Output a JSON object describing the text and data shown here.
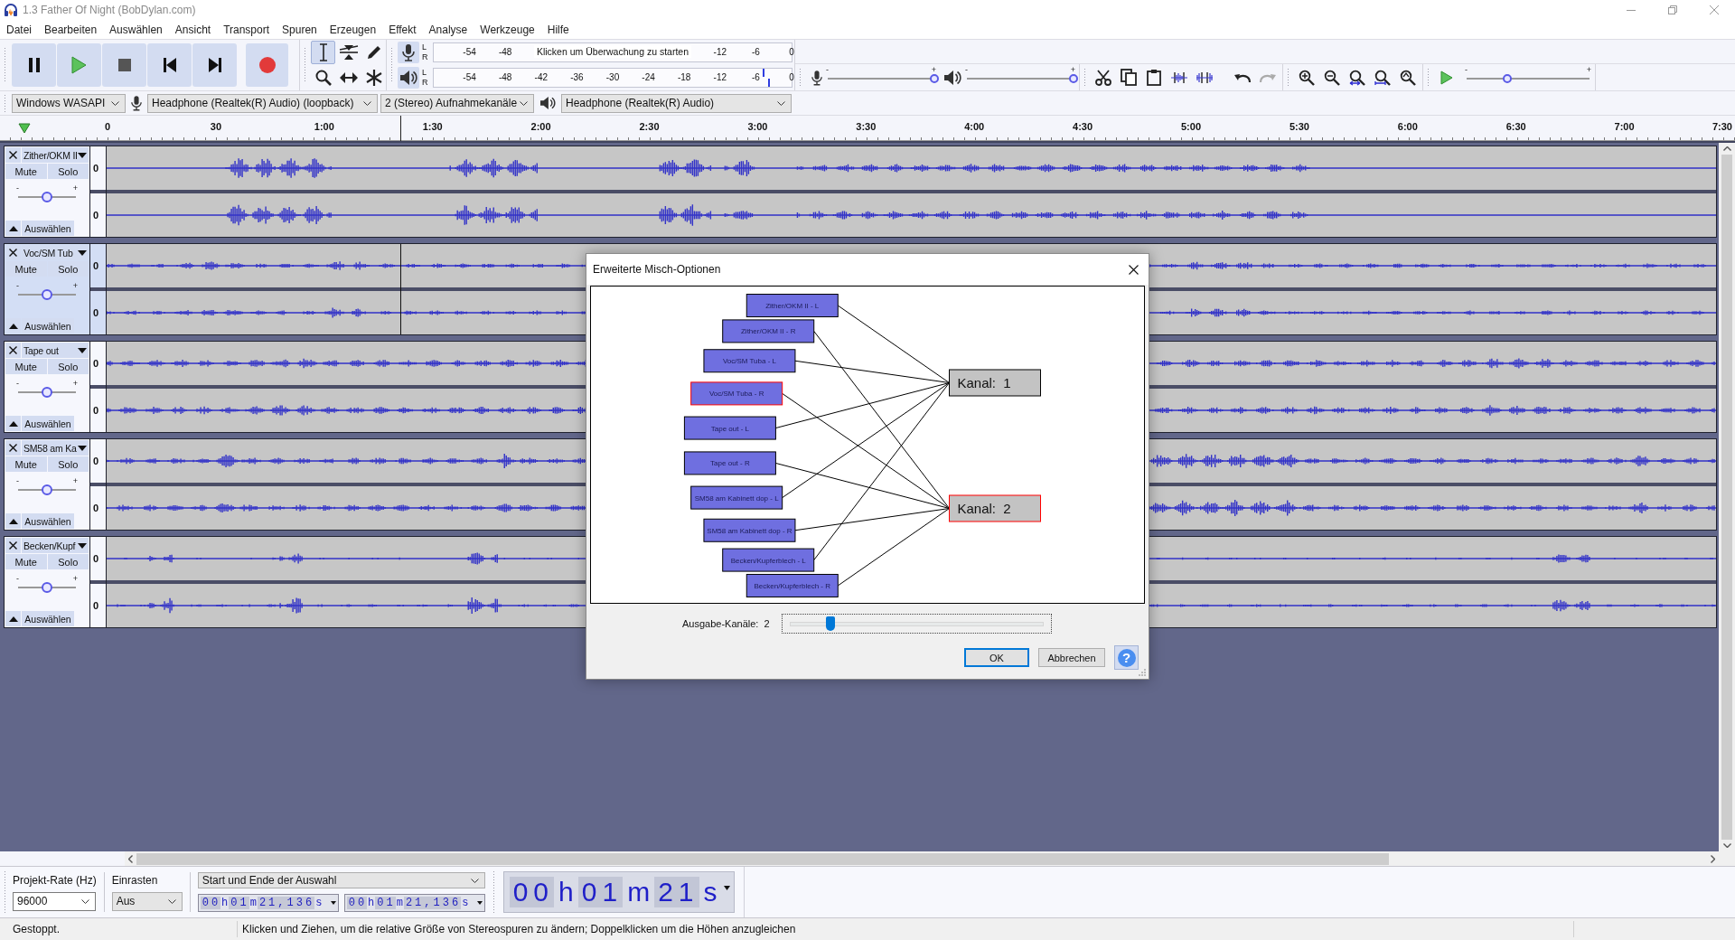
{
  "window": {
    "title": "1.3 Father Of Night (BobDylan.com)"
  },
  "menu": [
    "Datei",
    "Bearbeiten",
    "Auswählen",
    "Ansicht",
    "Transport",
    "Spuren",
    "Erzeugen",
    "Effekt",
    "Analyse",
    "Werkzeuge",
    "Hilfe"
  ],
  "transport": [
    {
      "kind": "pause"
    },
    {
      "kind": "play"
    },
    {
      "kind": "stop"
    },
    {
      "kind": "skip-start"
    },
    {
      "kind": "skip-end"
    },
    {
      "kind": "record"
    }
  ],
  "tools": [
    {
      "kind": "select",
      "selected": true
    },
    {
      "kind": "envelope",
      "selected": false
    },
    {
      "kind": "draw",
      "selected": false
    },
    {
      "kind": "zoom",
      "selected": false
    },
    {
      "kind": "time-shift",
      "selected": false
    },
    {
      "kind": "multi",
      "selected": false
    }
  ],
  "recording_meter": {
    "channels": [
      {
        "label": "L"
      },
      {
        "label": "R"
      }
    ],
    "scale_start": [
      "-54",
      "-48"
    ],
    "hint": "Klicken um Überwachung zu starten",
    "scale_end": [
      "-12",
      "-6",
      "0"
    ]
  },
  "playback_meter": {
    "channels": [
      {
        "label": "L",
        "level": 0.92
      },
      {
        "label": "R",
        "level": 0.935
      }
    ],
    "scale": [
      "-54",
      "-48",
      "-42",
      "-36",
      "-30",
      "-24",
      "-18",
      "-12",
      "-6",
      "0"
    ]
  },
  "mixer": [
    {
      "kind": "recording",
      "minus": "-",
      "plus": "+",
      "level": 1
    },
    {
      "kind": "playback",
      "minus": "-",
      "plus": "+",
      "level": 1
    }
  ],
  "edit": [
    {
      "kind": "cut"
    },
    {
      "kind": "copy"
    },
    {
      "kind": "paste"
    },
    {
      "kind": "trim"
    },
    {
      "kind": "silence"
    }
  ],
  "history": [
    {
      "kind": "undo",
      "disabled": false
    },
    {
      "kind": "redo",
      "disabled": true
    }
  ],
  "zoom": [
    {
      "kind": "zoom-in"
    },
    {
      "kind": "zoom-out"
    },
    {
      "kind": "fit-selection"
    },
    {
      "kind": "fit-project"
    },
    {
      "kind": "zoom-toggle"
    }
  ],
  "play_at_speed": {
    "minus": "-",
    "plus": "+",
    "level": 0.33
  },
  "devices": {
    "host": "Windows WASAPI",
    "recording_device": "Headphone (Realtek(R) Audio) (loopback)",
    "recording_channels": "2 (Stereo) Aufnahmekanäle",
    "playback_device": "Headphone (Realtek(R) Audio)"
  },
  "timeline": [
    "0",
    "30",
    "1:00",
    "1:30",
    "2:00",
    "2:30",
    "3:00",
    "3:30",
    "4:00",
    "4:30",
    "5:00",
    "5:30",
    "6:00",
    "6:30",
    "7:00",
    "7:30"
  ],
  "tracks": [
    {
      "name": "Zither/OKM II",
      "selected": false,
      "mute": "Mute",
      "solo": "Solo",
      "gain": {
        "minus": "-",
        "plus": "+",
        "level": 0.5
      },
      "select": "Auswählen",
      "channels": [
        {
          "scale": "0"
        },
        {
          "scale": "0"
        }
      ]
    },
    {
      "name": "Voc/SM Tub",
      "selected": true,
      "mute": "Mute",
      "solo": "Solo",
      "gain": {
        "minus": "-",
        "plus": "+",
        "level": 0.5
      },
      "select": "Auswählen",
      "channels": [
        {
          "scale": "0"
        },
        {
          "scale": "0"
        }
      ]
    },
    {
      "name": "Tape out",
      "selected": false,
      "mute": "Mute",
      "solo": "Solo",
      "gain": {
        "minus": "-",
        "plus": "+",
        "level": 0.5
      },
      "select": "Auswählen",
      "channels": [
        {
          "scale": "0"
        },
        {
          "scale": "0"
        }
      ]
    },
    {
      "name": "SM58 am Ka",
      "selected": false,
      "mute": "Mute",
      "solo": "Solo",
      "gain": {
        "minus": "-",
        "plus": "+",
        "level": 0.5
      },
      "select": "Auswählen",
      "channels": [
        {
          "scale": "0"
        },
        {
          "scale": "0"
        }
      ]
    },
    {
      "name": "Becken/Kupf",
      "selected": false,
      "mute": "Mute",
      "solo": "Solo",
      "gain": {
        "minus": "-",
        "plus": "+",
        "level": 0.5
      },
      "select": "Auswählen",
      "channels": [
        {
          "scale": "0"
        },
        {
          "scale": "0"
        }
      ]
    }
  ],
  "mix_dialog": {
    "title": "Erweiterte Misch-Optionen",
    "tracks": [
      {
        "label": "Zither/OKM II - L",
        "selected": false,
        "routes": [
          true,
          false
        ]
      },
      {
        "label": "Zither/OKM II - R",
        "selected": false,
        "routes": [
          false,
          true
        ]
      },
      {
        "label": "Voc/SM Tuba - L",
        "selected": false,
        "routes": [
          true,
          false
        ]
      },
      {
        "label": "Voc/SM Tuba - R",
        "selected": true,
        "routes": [
          false,
          true
        ]
      },
      {
        "label": "Tape out - L",
        "selected": false,
        "routes": [
          true,
          false
        ]
      },
      {
        "label": "Tape out - R",
        "selected": false,
        "routes": [
          false,
          true
        ]
      },
      {
        "label": "SM58 am Kabinett dop - L",
        "selected": false,
        "routes": [
          true,
          false
        ]
      },
      {
        "label": "SM58 am Kabinett dop - R",
        "selected": false,
        "routes": [
          false,
          true
        ]
      },
      {
        "label": "Becken/Kupferblech - L",
        "selected": false,
        "routes": [
          true,
          false
        ]
      },
      {
        "label": "Becken/Kupferblech - R",
        "selected": false,
        "routes": [
          false,
          true
        ]
      }
    ],
    "channels": [
      {
        "label": "Kanal:  1",
        "selected": false
      },
      {
        "label": "Kanal:  2",
        "selected": true
      }
    ],
    "output_channels": {
      "label": "Ausgabe-Kanäle:  2",
      "level": 0.157
    },
    "buttons": [
      {
        "label": "OK",
        "default": true
      },
      {
        "label": "Abbrechen",
        "default": false
      }
    ],
    "help": "?"
  },
  "selection_toolbar": {
    "rate_label": "Projekt-Rate (Hz)",
    "rate": "96000",
    "snap_label": "Einrasten",
    "snap": "Aus",
    "mode": "Start und Ende der Auswahl",
    "start": [
      {
        "digits": "00",
        "unit": "h"
      },
      {
        "digits": "01",
        "unit": "m"
      },
      {
        "digits": "21,136",
        "unit": "s"
      }
    ],
    "end": [
      {
        "digits": "00",
        "unit": "h"
      },
      {
        "digits": "01",
        "unit": "m"
      },
      {
        "digits": "21,136",
        "unit": "s"
      }
    ]
  },
  "time_display": [
    {
      "digits": "00",
      "unit": "h"
    },
    {
      "digits": "01",
      "unit": "m"
    },
    {
      "digits": "21",
      "unit": "s"
    }
  ],
  "status_bar": {
    "state": "Gestoppt.",
    "message": "Klicken und Ziehen, um die relative Größe von Stereospuren zu ändern; Doppelklicken um die Höhen anzugleichen"
  }
}
